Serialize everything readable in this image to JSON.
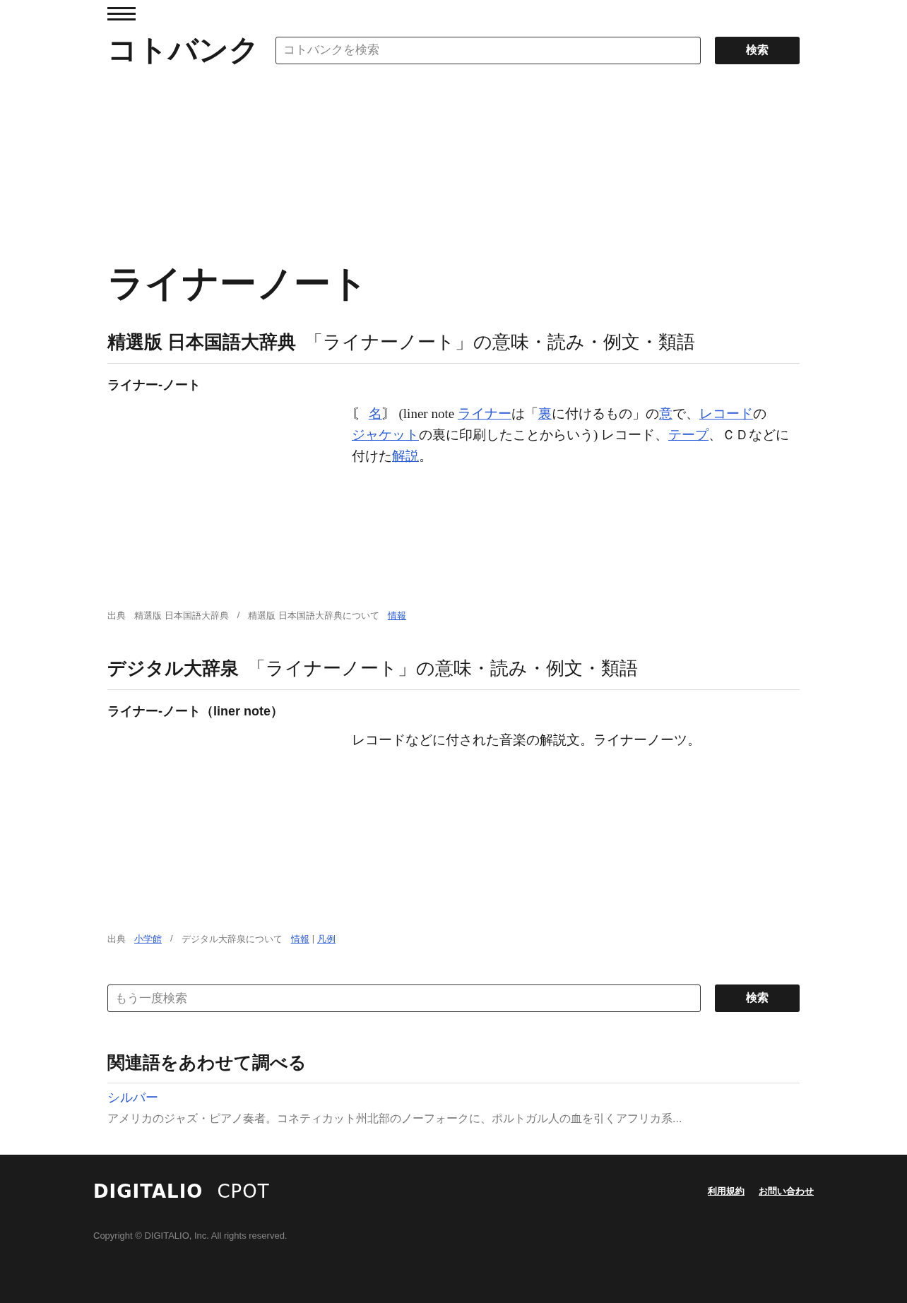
{
  "header": {
    "logo": "コトバンク",
    "search": {
      "placeholder": "コトバンクを検索"
    },
    "search_button": "検索"
  },
  "title": "ライナーノート",
  "sections": [
    {
      "dictionary": "精選版 日本国語大辞典",
      "subtitle": "「ライナーノート」の意味・読み・例文・類語",
      "entry": "ライナー-ノート",
      "definition": [
        {
          "text": "〘 ",
          "kind": "text"
        },
        {
          "text": "名",
          "kind": "link"
        },
        {
          "text": "〙 (liner note ",
          "kind": "text"
        },
        {
          "text": "ライナー",
          "kind": "link"
        },
        {
          "text": "は「",
          "kind": "text"
        },
        {
          "text": "裏",
          "kind": "link"
        },
        {
          "text": "に付けるもの」の",
          "kind": "text"
        },
        {
          "text": "意",
          "kind": "link"
        },
        {
          "text": "で、",
          "kind": "text"
        },
        {
          "text": "レコード",
          "kind": "link"
        },
        {
          "text": "の",
          "kind": "text"
        },
        {
          "text": "ジャケット",
          "kind": "link"
        },
        {
          "text": "の裏に印刷したことからいう) レコード、",
          "kind": "text"
        },
        {
          "text": "テープ",
          "kind": "link"
        },
        {
          "text": "、ＣＤなどに付けた",
          "kind": "text"
        },
        {
          "text": "解説",
          "kind": "link"
        },
        {
          "text": "。",
          "kind": "text"
        }
      ],
      "source": [
        {
          "kind": "text",
          "text": "出典"
        },
        {
          "kind": "text",
          "text": "精選版 日本国語大辞典"
        },
        {
          "kind": "sep",
          "text": "/"
        },
        {
          "kind": "text",
          "text": "精選版 日本国語大辞典について"
        },
        {
          "kind": "link",
          "text": "情報"
        }
      ]
    },
    {
      "dictionary": "デジタル大辞泉",
      "subtitle": "「ライナーノート」の意味・読み・例文・類語",
      "entry": "ライナー-ノート（liner note）",
      "definition": [
        {
          "text": "レコードなどに付された音楽の解説文。ライナーノーツ。",
          "kind": "text"
        }
      ],
      "source": [
        {
          "kind": "text",
          "text": "出典"
        },
        {
          "kind": "link",
          "text": "小学館"
        },
        {
          "kind": "sep",
          "text": "/"
        },
        {
          "kind": "text",
          "text": "デジタル大辞泉について"
        },
        {
          "kind": "link",
          "text": "情報"
        },
        {
          "kind": "pipe",
          "text": "|"
        },
        {
          "kind": "link",
          "text": "凡例"
        }
      ]
    }
  ],
  "search_again": {
    "placeholder": "もう一度検索",
    "button": "検索"
  },
  "related": {
    "heading": "関連語をあわせて調べる",
    "items": [
      {
        "term": "シルバー",
        "description": "アメリカのジャズ・ピアノ奏者。コネティカット州北部のノーフォークに、ポルトガル人の血を引くアフリカ系..."
      }
    ]
  },
  "footer": {
    "logos": [
      "DIGITALIO",
      "CPOT"
    ],
    "links": [
      "利用規約",
      "お問い合わせ"
    ],
    "copyright": "Copyright © DIGITALIO, Inc. All rights reserved."
  }
}
